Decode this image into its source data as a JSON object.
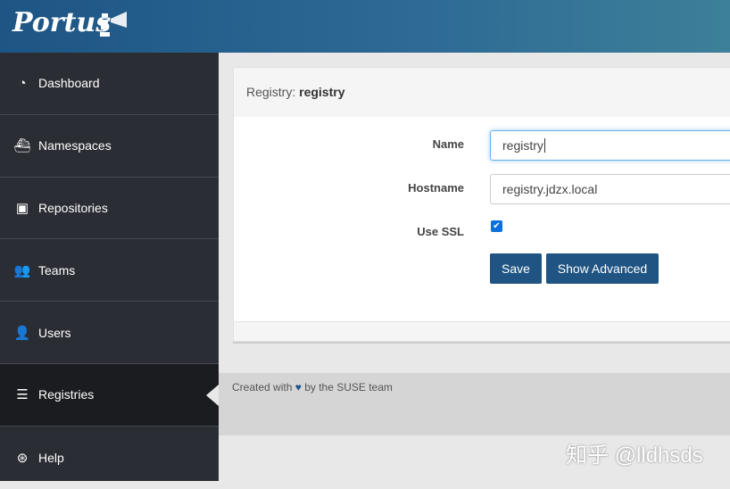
{
  "header": {
    "logo": "Portus"
  },
  "sidebar": {
    "items": [
      {
        "label": "Dashboard",
        "icon": "dashboard-icon",
        "glyph": "◔"
      },
      {
        "label": "Namespaces",
        "icon": "ship-icon",
        "glyph": "⛴"
      },
      {
        "label": "Repositories",
        "icon": "archive-icon",
        "glyph": "▣"
      },
      {
        "label": "Teams",
        "icon": "users-icon",
        "glyph": "👥"
      },
      {
        "label": "Users",
        "icon": "user-icon",
        "glyph": "👤"
      },
      {
        "label": "Registries",
        "icon": "server-icon",
        "glyph": "☰"
      },
      {
        "label": "Help",
        "icon": "life-ring-icon",
        "glyph": "⊛"
      }
    ],
    "active": "Registries"
  },
  "card": {
    "title_prefix": "Registry:",
    "title_name": "registry",
    "form": {
      "name_label": "Name",
      "name_value": "registry",
      "hostname_label": "Hostname",
      "hostname_value": "registry.jdzx.local",
      "ssl_label": "Use SSL",
      "ssl_checked": true
    },
    "save_label": "Save",
    "advanced_label": "Show Advanced"
  },
  "footer": {
    "text_before": "Created with",
    "text_after": "by the SUSE team"
  },
  "watermark": "知乎 @lldhsds",
  "colors": {
    "primary": "#1f5483",
    "sidebar": "#2a2d33"
  }
}
